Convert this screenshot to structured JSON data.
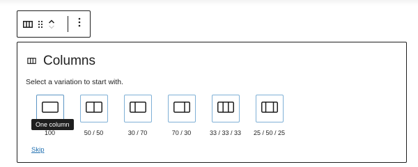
{
  "block": {
    "title": "Columns",
    "instructions": "Select a variation to start with.",
    "skip_label": "Skip"
  },
  "variations": [
    {
      "label": "100",
      "icon": "one-column-icon"
    },
    {
      "label": "50 / 50",
      "icon": "two-columns-equal-icon"
    },
    {
      "label": "30 / 70",
      "icon": "two-columns-30-70-icon"
    },
    {
      "label": "70 / 30",
      "icon": "two-columns-70-30-icon"
    },
    {
      "label": "33 / 33 / 33",
      "icon": "three-columns-equal-icon"
    },
    {
      "label": "25 / 50 / 25",
      "icon": "three-columns-wide-center-icon"
    }
  ],
  "tooltip": {
    "text": "One column"
  },
  "toolbar": {
    "icons": [
      "columns-block-icon",
      "drag-handle-icon",
      "move-up-icon",
      "move-down-icon",
      "more-options-icon"
    ]
  },
  "colors": {
    "accent": "#2271b1",
    "variation_border": "#7fb0d6",
    "dark": "#1e1e1e"
  }
}
